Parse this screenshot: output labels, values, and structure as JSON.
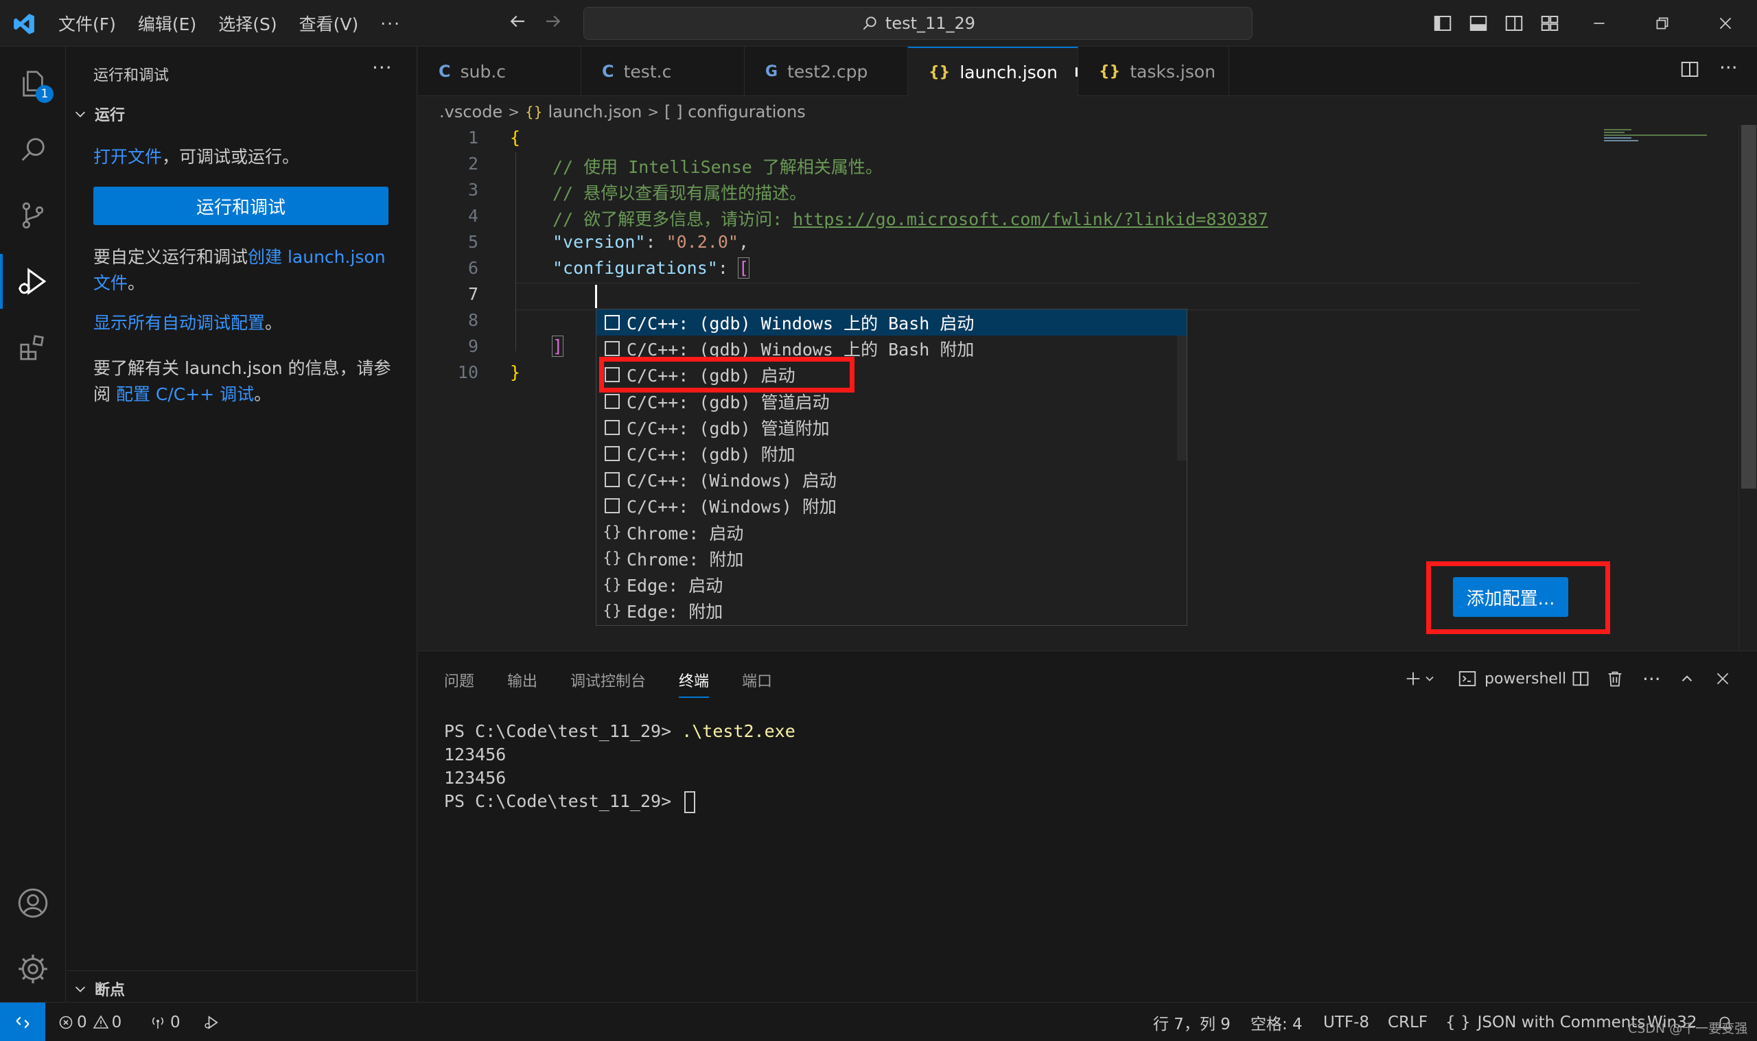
{
  "titlebar": {
    "menu": [
      "文件(F)",
      "编辑(E)",
      "选择(S)",
      "查看(V)",
      "···"
    ],
    "search_text": "test_11_29"
  },
  "activity": {
    "explorer_badge": "1"
  },
  "sidebar": {
    "title": "运行和调试",
    "more": "···",
    "run_section": "运行",
    "open_file_link": "打开文件",
    "open_file_rest": "，可调试或运行。",
    "run_button": "运行和调试",
    "custom_text": "要自定义运行和调试",
    "create_link": "创建 launch.json 文件",
    "custom_end": "。",
    "show_all_link": "显示所有自动调试配置",
    "show_all_end": "。",
    "learn_text": "要了解有关 launch.json 的信息，请参阅",
    "learn_link": "配置 C/C++ 调试",
    "learn_end": "。",
    "breakpoints_section": "断点"
  },
  "tabs": [
    {
      "label": "sub.c",
      "icon": "C"
    },
    {
      "label": "test.c",
      "icon": "C"
    },
    {
      "label": "test2.cpp",
      "icon": "G"
    },
    {
      "label": "launch.json",
      "icon": "{}"
    },
    {
      "label": "tasks.json",
      "icon": "{}"
    }
  ],
  "breadcrumb": {
    "folder": ".vscode",
    "file": "launch.json",
    "symbol": "[ ] configurations"
  },
  "editor": {
    "line_numbers": [
      "1",
      "2",
      "3",
      "4",
      "5",
      "6",
      "7",
      "8",
      "9",
      "10"
    ],
    "current_line": "7",
    "code": {
      "l1": "{",
      "l2": "// 使用 IntelliSense 了解相关属性。",
      "l3": "// 悬停以查看现有属性的描述。",
      "l4_prefix": "// 欲了解更多信息，请访问: ",
      "l4_url": "https://go.microsoft.com/fwlink/?linkid=830387",
      "l5_key": "\"version\"",
      "l5_val": "\"0.2.0\"",
      "l6_key": "\"configurations\"",
      "l6_bracket": "[",
      "l9_bracket": "]",
      "l10": "}"
    }
  },
  "suggest": {
    "items": [
      {
        "label": "C/C++: (gdb) Windows 上的 Bash 启动",
        "icon": "box"
      },
      {
        "label": "C/C++: (gdb) Windows 上的 Bash 附加",
        "icon": "box"
      },
      {
        "label": "C/C++: (gdb) 启动",
        "icon": "box"
      },
      {
        "label": "C/C++: (gdb) 管道启动",
        "icon": "box"
      },
      {
        "label": "C/C++: (gdb) 管道附加",
        "icon": "box"
      },
      {
        "label": "C/C++: (gdb) 附加",
        "icon": "box"
      },
      {
        "label": "C/C++: (Windows) 启动",
        "icon": "box"
      },
      {
        "label": "C/C++: (Windows) 附加",
        "icon": "box"
      },
      {
        "label": "Chrome: 启动",
        "icon": "{}"
      },
      {
        "label": "Chrome: 附加",
        "icon": "{}"
      },
      {
        "label": "Edge: 启动",
        "icon": "{}"
      },
      {
        "label": "Edge: 附加",
        "icon": "{}"
      }
    ],
    "selected_index": 0
  },
  "add_config_button": "添加配置...",
  "panel": {
    "tabs": [
      "问题",
      "输出",
      "调试控制台",
      "终端",
      "端口"
    ],
    "active_tab": "终端",
    "shell": "powershell",
    "terminal": {
      "prompt1": "PS C:\\Code\\test_11_29> ",
      "cmd1": ".\\test2.exe",
      "out1": "123456",
      "out2": "123456",
      "prompt2": "PS C:\\Code\\test_11_29> "
    }
  },
  "statusbar": {
    "errors": "0",
    "warnings": "0",
    "ports": "0",
    "position": "行 7，列 9",
    "spaces": "空格: 4",
    "encoding": "UTF-8",
    "eol": "CRLF",
    "language": "JSON with Comments",
    "platform": "Win32"
  },
  "watermark": "CSDN @千一要变强",
  "colors": {
    "accent": "#0078d4",
    "highlight_box": "#ff1a1a",
    "selected_item": "#04395e"
  }
}
